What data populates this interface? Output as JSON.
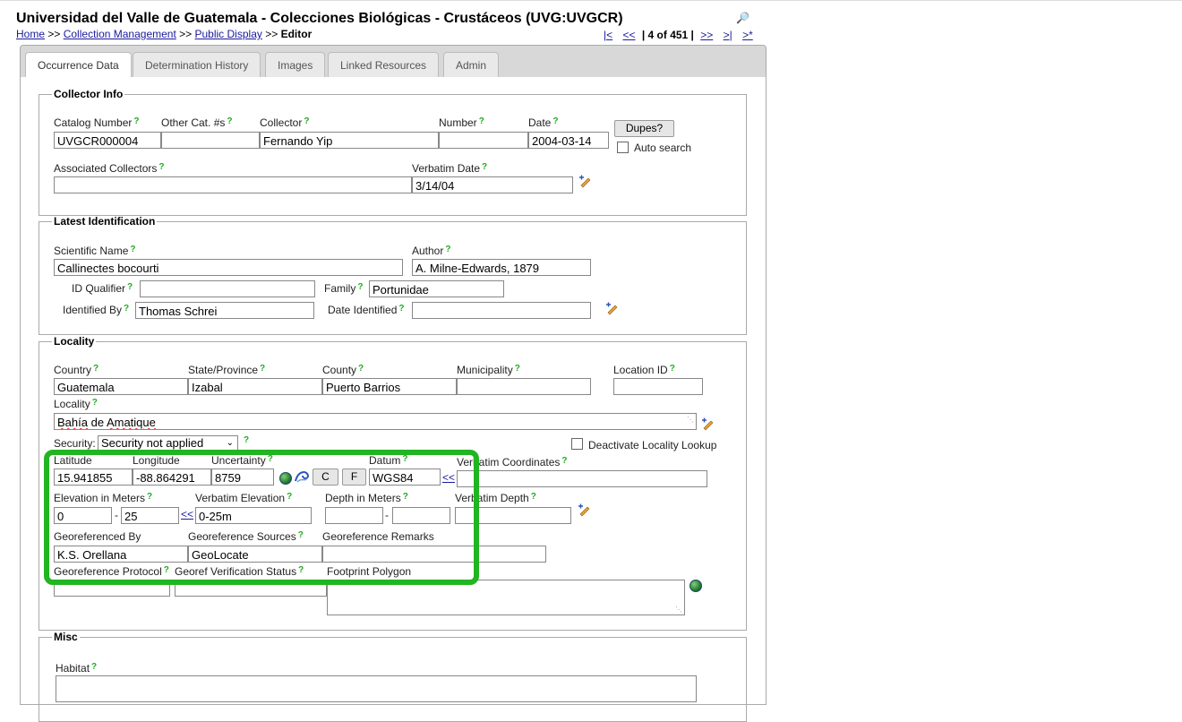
{
  "header": {
    "title": "Universidad del Valle de Guatemala - Colecciones Biológicas - Crustáceos (UVG:UVGCR)",
    "breadcrumbs": [
      "Home",
      "Collection Management",
      "Public Display"
    ],
    "breadcrumb_current": "Editor",
    "separator": ">>",
    "pager": {
      "first": "|<",
      "prev": "<<",
      "position": "| 4 of 451 |",
      "next": ">>",
      "last": ">|",
      "new": ">*"
    }
  },
  "tabs": [
    "Occurrence Data",
    "Determination History",
    "Images",
    "Linked Resources",
    "Admin"
  ],
  "collector_info": {
    "legend": "Collector Info",
    "catalog_number_label": "Catalog Number",
    "catalog_number": "UVGCR000004",
    "other_cat_label": "Other Cat. #s",
    "other_cat": "",
    "collector_label": "Collector",
    "collector": "Fernando Yip",
    "number_label": "Number",
    "number": "",
    "date_label": "Date",
    "date": "2004-03-14",
    "dupes_button": "Dupes?",
    "auto_search_label": "Auto search",
    "associated_collectors_label": "Associated Collectors",
    "associated_collectors": "",
    "verbatim_date_label": "Verbatim Date",
    "verbatim_date": "3/14/04"
  },
  "identification": {
    "legend": "Latest Identification",
    "scientific_name_label": "Scientific Name",
    "scientific_name": "Callinectes bocourti",
    "author_label": "Author",
    "author": "A. Milne-Edwards, 1879",
    "id_qualifier_label": "ID Qualifier",
    "id_qualifier": "",
    "family_label": "Family",
    "family": "Portunidae",
    "identified_by_label": "Identified By",
    "identified_by": "Thomas Schrei",
    "date_identified_label": "Date Identified",
    "date_identified": ""
  },
  "locality": {
    "legend": "Locality",
    "country_label": "Country",
    "country": "Guatemala",
    "state_label": "State/Province",
    "state": "Izabal",
    "county_label": "County",
    "county": "Puerto Barrios",
    "municipality_label": "Municipality",
    "municipality": "",
    "location_id_label": "Location ID",
    "location_id": "",
    "locality_label": "Locality",
    "locality_part1": "Bahía",
    "locality_part2": " de ",
    "locality_part3": "Amatique",
    "security_label": "Security:",
    "security_value": "Security not applied",
    "deactivate_label": "Deactivate Locality Lookup",
    "latitude_label": "Latitude",
    "latitude": "15.941855",
    "longitude_label": "Longitude",
    "longitude": "-88.864291",
    "uncertainty_label": "Uncertainty",
    "uncertainty": "8759",
    "c_button": "C",
    "f_button": "F",
    "datum_label": "Datum",
    "datum": "WGS84",
    "copy_link": "<<",
    "verbatim_coordinates_label": "Verbatim Coordinates",
    "verbatim_coordinates": "",
    "elevation_label": "Elevation in Meters",
    "elevation_min": "0",
    "elevation_max": "25",
    "verbatim_elevation_label": "Verbatim Elevation",
    "verbatim_elevation": "0-25m",
    "depth_label": "Depth in Meters",
    "depth_min": "",
    "depth_max": "",
    "verbatim_depth_label": "Verbatim Depth",
    "verbatim_depth": "",
    "georeferenced_by_label": "Georeferenced By",
    "georeferenced_by": "K.S. Orellana",
    "georeference_sources_label": "Georeference Sources",
    "georeference_sources": "GeoLocate",
    "georeference_remarks_label": "Georeference Remarks",
    "georeference_remarks": "",
    "georeference_protocol_label": "Georeference Protocol",
    "georef_verification_label": "Georef Verification Status",
    "footprint_label": "Footprint Polygon",
    "dash": "-"
  },
  "misc": {
    "legend": "Misc",
    "habitat_label": "Habitat"
  },
  "help_mark": "?",
  "colors": {
    "highlight": "#21b521",
    "help": "#22aa22",
    "link": "#1a1a9e"
  }
}
